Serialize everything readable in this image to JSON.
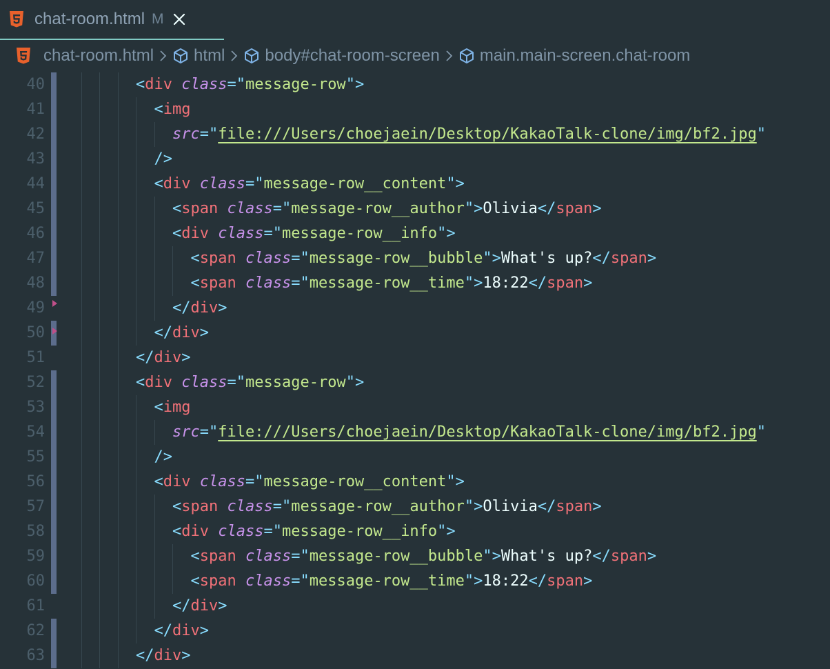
{
  "tab": {
    "title": "chat-room.html",
    "status": "M",
    "icon": "html5-icon",
    "close_icon": "close-icon"
  },
  "breadcrumb": {
    "items": [
      {
        "label": "chat-room.html",
        "icon": "html5-icon"
      },
      {
        "label": "html",
        "icon": "element-cube-icon"
      },
      {
        "label": "body#chat-room-screen",
        "icon": "element-cube-icon"
      },
      {
        "label": "main.main-screen.chat-room",
        "icon": "element-cube-icon"
      }
    ]
  },
  "colors": {
    "background": "#263238",
    "tag": "#f07178",
    "punctuation": "#89ddff",
    "attribute": "#c792ea",
    "string": "#c3e88d",
    "text": "#eeffff",
    "line_number": "#4c5f6b",
    "modified_bar": "#5c6d8c",
    "html5_icon": "#e8612c"
  },
  "lines": [
    {
      "n": "40",
      "indent": 4,
      "bar": true,
      "tokens": [
        [
          "punc",
          "<"
        ],
        [
          "tag",
          "div"
        ],
        [
          "text",
          " "
        ],
        [
          "attr",
          "class"
        ],
        [
          "punc",
          "="
        ],
        [
          "punc",
          "\""
        ],
        [
          "str",
          "message-row"
        ],
        [
          "punc",
          "\""
        ],
        [
          "punc",
          ">"
        ]
      ]
    },
    {
      "n": "41",
      "indent": 5,
      "bar": true,
      "tokens": [
        [
          "punc",
          "<"
        ],
        [
          "tag",
          "img"
        ]
      ]
    },
    {
      "n": "42",
      "indent": 6,
      "bar": true,
      "tokens": [
        [
          "attr",
          "src"
        ],
        [
          "punc",
          "="
        ],
        [
          "punc",
          "\""
        ],
        [
          "link",
          "file:///Users/choejaein/Desktop/KakaoTalk-clone/img/bf2.jpg"
        ],
        [
          "punc",
          "\""
        ]
      ]
    },
    {
      "n": "43",
      "indent": 5,
      "bar": true,
      "tokens": [
        [
          "punc",
          "/>"
        ]
      ]
    },
    {
      "n": "44",
      "indent": 5,
      "bar": true,
      "tokens": [
        [
          "punc",
          "<"
        ],
        [
          "tag",
          "div"
        ],
        [
          "text",
          " "
        ],
        [
          "attr",
          "class"
        ],
        [
          "punc",
          "="
        ],
        [
          "punc",
          "\""
        ],
        [
          "str",
          "message-row__content"
        ],
        [
          "punc",
          "\""
        ],
        [
          "punc",
          ">"
        ]
      ]
    },
    {
      "n": "45",
      "indent": 6,
      "bar": true,
      "tokens": [
        [
          "punc",
          "<"
        ],
        [
          "tag",
          "span"
        ],
        [
          "text",
          " "
        ],
        [
          "attr",
          "class"
        ],
        [
          "punc",
          "="
        ],
        [
          "punc",
          "\""
        ],
        [
          "str",
          "message-row__author"
        ],
        [
          "punc",
          "\""
        ],
        [
          "punc",
          ">"
        ],
        [
          "text",
          "Olivia"
        ],
        [
          "punc",
          "</"
        ],
        [
          "tag",
          "span"
        ],
        [
          "punc",
          ">"
        ]
      ]
    },
    {
      "n": "46",
      "indent": 6,
      "bar": true,
      "tokens": [
        [
          "punc",
          "<"
        ],
        [
          "tag",
          "div"
        ],
        [
          "text",
          " "
        ],
        [
          "attr",
          "class"
        ],
        [
          "punc",
          "="
        ],
        [
          "punc",
          "\""
        ],
        [
          "str",
          "message-row__info"
        ],
        [
          "punc",
          "\""
        ],
        [
          "punc",
          ">"
        ]
      ]
    },
    {
      "n": "47",
      "indent": 7,
      "bar": true,
      "tokens": [
        [
          "punc",
          "<"
        ],
        [
          "tag",
          "span"
        ],
        [
          "text",
          " "
        ],
        [
          "attr",
          "class"
        ],
        [
          "punc",
          "="
        ],
        [
          "punc",
          "\""
        ],
        [
          "str",
          "message-row__bubble"
        ],
        [
          "punc",
          "\""
        ],
        [
          "punc",
          ">"
        ],
        [
          "text",
          "What's up?"
        ],
        [
          "punc",
          "</"
        ],
        [
          "tag",
          "span"
        ],
        [
          "punc",
          ">"
        ]
      ]
    },
    {
      "n": "48",
      "indent": 7,
      "bar": true,
      "tokens": [
        [
          "punc",
          "<"
        ],
        [
          "tag",
          "span"
        ],
        [
          "text",
          " "
        ],
        [
          "attr",
          "class"
        ],
        [
          "punc",
          "="
        ],
        [
          "punc",
          "\""
        ],
        [
          "str",
          "message-row__time"
        ],
        [
          "punc",
          "\""
        ],
        [
          "punc",
          ">"
        ],
        [
          "text",
          "18:22"
        ],
        [
          "punc",
          "</"
        ],
        [
          "tag",
          "span"
        ],
        [
          "punc",
          ">"
        ]
      ]
    },
    {
      "n": "49",
      "indent": 6,
      "bar": false,
      "tokens": [
        [
          "punc",
          "</"
        ],
        [
          "tag",
          "div"
        ],
        [
          "punc",
          ">"
        ]
      ]
    },
    {
      "n": "50",
      "indent": 5,
      "bar": true,
      "tokens": [
        [
          "punc",
          "</"
        ],
        [
          "tag",
          "div"
        ],
        [
          "punc",
          ">"
        ]
      ]
    },
    {
      "n": "51",
      "indent": 4,
      "bar": false,
      "tokens": [
        [
          "punc",
          "</"
        ],
        [
          "tag",
          "div"
        ],
        [
          "punc",
          ">"
        ]
      ]
    },
    {
      "n": "52",
      "indent": 4,
      "bar": true,
      "tokens": [
        [
          "punc",
          "<"
        ],
        [
          "tag",
          "div"
        ],
        [
          "text",
          " "
        ],
        [
          "attr",
          "class"
        ],
        [
          "punc",
          "="
        ],
        [
          "punc",
          "\""
        ],
        [
          "str",
          "message-row"
        ],
        [
          "punc",
          "\""
        ],
        [
          "punc",
          ">"
        ]
      ]
    },
    {
      "n": "53",
      "indent": 5,
      "bar": true,
      "tokens": [
        [
          "punc",
          "<"
        ],
        [
          "tag",
          "img"
        ]
      ]
    },
    {
      "n": "54",
      "indent": 6,
      "bar": true,
      "tokens": [
        [
          "attr",
          "src"
        ],
        [
          "punc",
          "="
        ],
        [
          "punc",
          "\""
        ],
        [
          "link",
          "file:///Users/choejaein/Desktop/KakaoTalk-clone/img/bf2.jpg"
        ],
        [
          "punc",
          "\""
        ]
      ]
    },
    {
      "n": "55",
      "indent": 5,
      "bar": true,
      "tokens": [
        [
          "punc",
          "/>"
        ]
      ]
    },
    {
      "n": "56",
      "indent": 5,
      "bar": true,
      "tokens": [
        [
          "punc",
          "<"
        ],
        [
          "tag",
          "div"
        ],
        [
          "text",
          " "
        ],
        [
          "attr",
          "class"
        ],
        [
          "punc",
          "="
        ],
        [
          "punc",
          "\""
        ],
        [
          "str",
          "message-row__content"
        ],
        [
          "punc",
          "\""
        ],
        [
          "punc",
          ">"
        ]
      ]
    },
    {
      "n": "57",
      "indent": 6,
      "bar": true,
      "tokens": [
        [
          "punc",
          "<"
        ],
        [
          "tag",
          "span"
        ],
        [
          "text",
          " "
        ],
        [
          "attr",
          "class"
        ],
        [
          "punc",
          "="
        ],
        [
          "punc",
          "\""
        ],
        [
          "str",
          "message-row__author"
        ],
        [
          "punc",
          "\""
        ],
        [
          "punc",
          ">"
        ],
        [
          "text",
          "Olivia"
        ],
        [
          "punc",
          "</"
        ],
        [
          "tag",
          "span"
        ],
        [
          "punc",
          ">"
        ]
      ]
    },
    {
      "n": "58",
      "indent": 6,
      "bar": true,
      "tokens": [
        [
          "punc",
          "<"
        ],
        [
          "tag",
          "div"
        ],
        [
          "text",
          " "
        ],
        [
          "attr",
          "class"
        ],
        [
          "punc",
          "="
        ],
        [
          "punc",
          "\""
        ],
        [
          "str",
          "message-row__info"
        ],
        [
          "punc",
          "\""
        ],
        [
          "punc",
          ">"
        ]
      ]
    },
    {
      "n": "59",
      "indent": 7,
      "bar": true,
      "tokens": [
        [
          "punc",
          "<"
        ],
        [
          "tag",
          "span"
        ],
        [
          "text",
          " "
        ],
        [
          "attr",
          "class"
        ],
        [
          "punc",
          "="
        ],
        [
          "punc",
          "\""
        ],
        [
          "str",
          "message-row__bubble"
        ],
        [
          "punc",
          "\""
        ],
        [
          "punc",
          ">"
        ],
        [
          "text",
          "What's up?"
        ],
        [
          "punc",
          "</"
        ],
        [
          "tag",
          "span"
        ],
        [
          "punc",
          ">"
        ]
      ]
    },
    {
      "n": "60",
      "indent": 7,
      "bar": true,
      "tokens": [
        [
          "punc",
          "<"
        ],
        [
          "tag",
          "span"
        ],
        [
          "text",
          " "
        ],
        [
          "attr",
          "class"
        ],
        [
          "punc",
          "="
        ],
        [
          "punc",
          "\""
        ],
        [
          "str",
          "message-row__time"
        ],
        [
          "punc",
          "\""
        ],
        [
          "punc",
          ">"
        ],
        [
          "text",
          "18:22"
        ],
        [
          "punc",
          "</"
        ],
        [
          "tag",
          "span"
        ],
        [
          "punc",
          ">"
        ]
      ]
    },
    {
      "n": "61",
      "indent": 6,
      "bar": false,
      "tokens": [
        [
          "punc",
          "</"
        ],
        [
          "tag",
          "div"
        ],
        [
          "punc",
          ">"
        ]
      ]
    },
    {
      "n": "62",
      "indent": 5,
      "bar": true,
      "tokens": [
        [
          "punc",
          "</"
        ],
        [
          "tag",
          "div"
        ],
        [
          "punc",
          ">"
        ]
      ]
    },
    {
      "n": "63",
      "indent": 4,
      "bar": true,
      "tokens": [
        [
          "punc",
          "</"
        ],
        [
          "tag",
          "div"
        ],
        [
          "punc",
          ">"
        ]
      ]
    }
  ]
}
